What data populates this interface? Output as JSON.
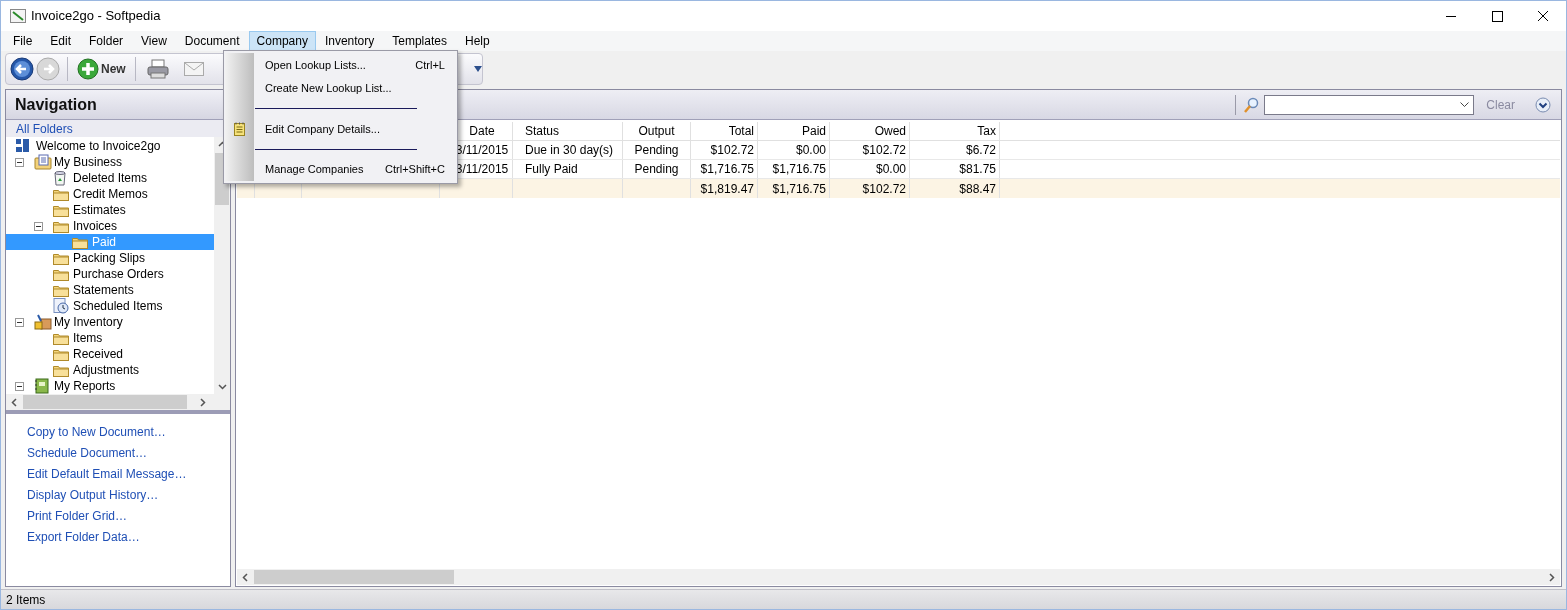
{
  "window": {
    "title": "Invoice2go - Softpedia"
  },
  "menu_bar": [
    {
      "label": "File",
      "selected": false
    },
    {
      "label": "Edit",
      "selected": false
    },
    {
      "label": "Folder",
      "selected": false
    },
    {
      "label": "View",
      "selected": false
    },
    {
      "label": "Document",
      "selected": false
    },
    {
      "label": "Company",
      "selected": true
    },
    {
      "label": "Inventory",
      "selected": false
    },
    {
      "label": "Templates",
      "selected": false
    },
    {
      "label": "Help",
      "selected": false
    }
  ],
  "company_menu": [
    {
      "kind": "item",
      "label": "Open Lookup Lists...",
      "shortcut": "Ctrl+L"
    },
    {
      "kind": "item",
      "label": "Create New Lookup List..."
    },
    {
      "kind": "separator"
    },
    {
      "kind": "icon_item",
      "label": "Edit Company Details..."
    },
    {
      "kind": "separator"
    },
    {
      "kind": "item",
      "label": "Manage Companies",
      "shortcut": "Ctrl+Shift+C"
    }
  ],
  "toolbar": {
    "new_button": "New"
  },
  "navigation": {
    "title": "Navigation",
    "all_folders": "All Folders",
    "tree": [
      {
        "kind": "welcome",
        "label": "Welcome to Invoice2go",
        "selected": false
      },
      {
        "kind": "business",
        "label": "My Business",
        "selected": false,
        "expanded": true,
        "children": [
          {
            "kind": "trash",
            "label": "Deleted Items",
            "selected": false
          },
          {
            "kind": "folder",
            "label": "Credit Memos",
            "selected": false
          },
          {
            "kind": "folder",
            "label": "Estimates",
            "selected": false
          },
          {
            "kind": "folder",
            "label": "Invoices",
            "selected": false,
            "expanded": true,
            "children": [
              {
                "kind": "folder",
                "label": "Paid",
                "selected": true
              }
            ]
          },
          {
            "kind": "folder",
            "label": "Packing Slips",
            "selected": false
          },
          {
            "kind": "folder",
            "label": "Purchase Orders",
            "selected": false
          },
          {
            "kind": "folder",
            "label": "Statements",
            "selected": false
          },
          {
            "kind": "schedule",
            "label": "Scheduled Items",
            "selected": false
          }
        ]
      },
      {
        "kind": "inventory",
        "label": "My Inventory",
        "selected": false,
        "expanded": true,
        "children": [
          {
            "kind": "folder",
            "label": "Items",
            "selected": false
          },
          {
            "kind": "folder",
            "label": "Received",
            "selected": false
          },
          {
            "kind": "folder",
            "label": "Adjustments",
            "selected": false
          }
        ]
      },
      {
        "kind": "reports",
        "label": "My Reports",
        "selected": false,
        "expanded": true
      }
    ],
    "tasks": [
      "Copy to New Document…",
      "Schedule Document…",
      "Edit Default Email Message…",
      "Display Output History…",
      "Print Folder Grid…",
      "Export Folder Data…"
    ]
  },
  "content": {
    "clear": "Clear",
    "table": {
      "columns": [
        {
          "label": "Date",
          "kind": "center"
        },
        {
          "label": "Status",
          "kind": "text"
        },
        {
          "label": "Output",
          "kind": "center"
        },
        {
          "label": "Total",
          "kind": "money"
        },
        {
          "label": "Paid",
          "kind": "money"
        },
        {
          "label": "Owed",
          "kind": "money"
        },
        {
          "label": "Tax",
          "kind": "money"
        }
      ],
      "rows": [
        [
          "3/11/2015",
          "Due in 30 day(s)",
          "Pending",
          "$102.72",
          "$0.00",
          "$102.72",
          "$6.72"
        ],
        [
          "3/11/2015",
          "Fully Paid",
          "Pending",
          "$1,716.75",
          "$1,716.75",
          "$0.00",
          "$81.75"
        ]
      ],
      "total_row": [
        "$1,819.47",
        "$1,716.75",
        "$102.72",
        "$88.47"
      ]
    }
  },
  "status_bar": "2 Items"
}
